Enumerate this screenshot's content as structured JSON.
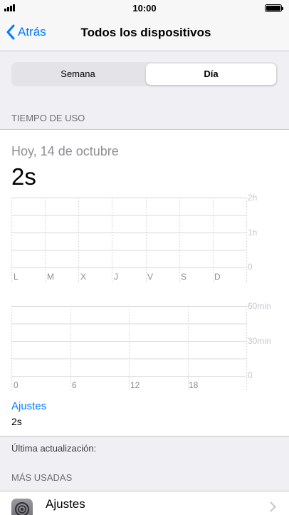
{
  "status_bar": {
    "time": "10:00"
  },
  "nav": {
    "back_label": "Atrás",
    "title": "Todos los dispositivos"
  },
  "segmented": {
    "options": [
      "Semana",
      "Día"
    ],
    "selected": "Día"
  },
  "usage": {
    "section_header": "TIEMPO DE USO",
    "date": "Hoy, 14 de octubre",
    "total": "2s"
  },
  "chart_data": [
    {
      "type": "bar",
      "categories": [
        "L",
        "M",
        "X",
        "J",
        "V",
        "S",
        "D"
      ],
      "values": [
        0,
        0,
        0,
        0,
        0,
        0,
        0
      ],
      "ytick_labels": [
        "2h",
        "1h",
        "0"
      ],
      "ylim": [
        0,
        2
      ],
      "grid": true
    },
    {
      "type": "bar",
      "x_tick_labels": [
        "0",
        "6",
        "12",
        "18"
      ],
      "ytick_labels": [
        "60min",
        "30min",
        "0"
      ],
      "ylim": [
        0,
        60
      ],
      "grid": true
    }
  ],
  "category_summary": {
    "label": "Ajustes",
    "value": "2s"
  },
  "last_update": "Última actualización:",
  "most_used": {
    "header": "MÁS USADAS",
    "items": [
      {
        "name": "Ajustes",
        "icon": "settings-gear-icon"
      }
    ]
  },
  "colors": {
    "accent": "#007aff",
    "background": "#efeff4",
    "separator": "#c8c7cc"
  }
}
